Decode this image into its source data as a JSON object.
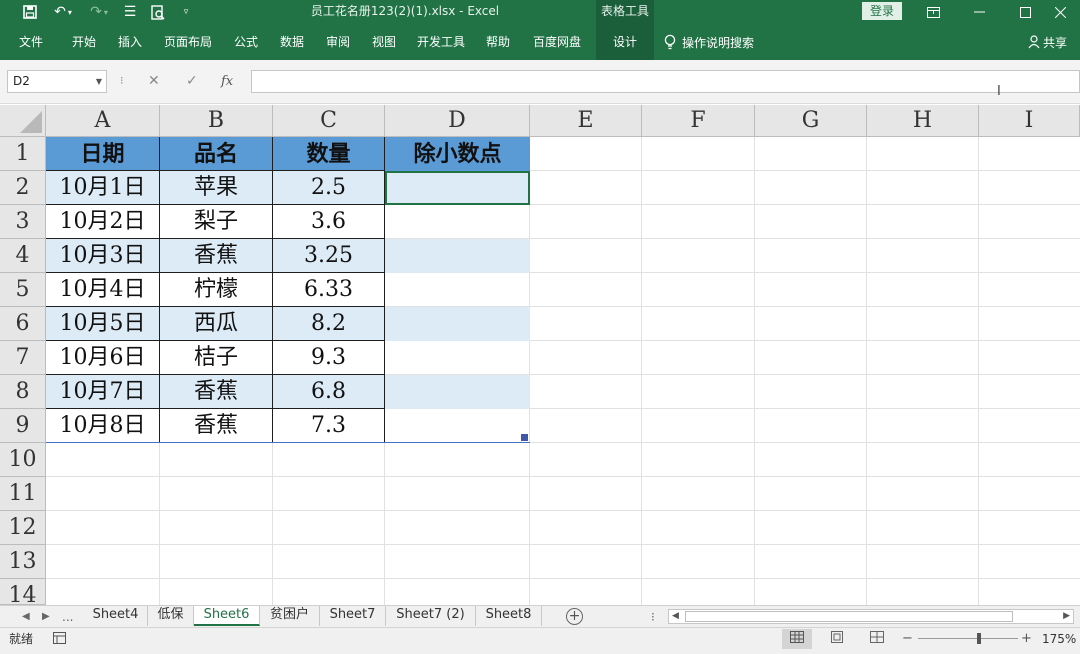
{
  "titlebar": {
    "save_icon": "save-icon",
    "undo_icon": "undo-icon",
    "redo_icon": "redo-icon",
    "title": "员工花名册123(2)(1).xlsx  -  Excel",
    "context_tab": "表格工具",
    "login": "登录"
  },
  "ribbon": {
    "tabs": [
      "文件",
      "开始",
      "插入",
      "页面布局",
      "公式",
      "数据",
      "审阅",
      "视图",
      "开发工具",
      "帮助",
      "百度网盘",
      "设计"
    ],
    "tell_me": "操作说明搜索",
    "share": "共享"
  },
  "formula_bar": {
    "name_box": "D2",
    "fx": "fx",
    "value": ""
  },
  "grid": {
    "columns": [
      "A",
      "B",
      "C",
      "D",
      "E",
      "F",
      "G",
      "H",
      "I"
    ],
    "rows": [
      "1",
      "2",
      "3",
      "4",
      "5",
      "6",
      "7",
      "8",
      "9",
      "10",
      "11",
      "12",
      "13",
      "14"
    ],
    "headers": [
      "日期",
      "品名",
      "数量",
      "除小数点"
    ],
    "data": [
      [
        "10月1日",
        "苹果",
        "2.5",
        ""
      ],
      [
        "10月2日",
        "梨子",
        "3.6",
        ""
      ],
      [
        "10月3日",
        "香蕉",
        "3.25",
        ""
      ],
      [
        "10月4日",
        "柠檬",
        "6.33",
        ""
      ],
      [
        "10月5日",
        "西瓜",
        "8.2",
        ""
      ],
      [
        "10月6日",
        "桔子",
        "9.3",
        ""
      ],
      [
        "10月7日",
        "香蕉",
        "6.8",
        ""
      ],
      [
        "10月8日",
        "香蕉",
        "7.3",
        ""
      ]
    ],
    "selected_cell": "D2",
    "header_color": "#5b9bd5",
    "band_color": "#ddebf7"
  },
  "sheets": {
    "more": "...",
    "tabs": [
      "Sheet4",
      "低保",
      "Sheet6",
      "贫困户",
      "Sheet7",
      "Sheet7 (2)",
      "Sheet8"
    ],
    "active": "Sheet6"
  },
  "status": {
    "ready": "就绪",
    "zoom": "175%"
  }
}
